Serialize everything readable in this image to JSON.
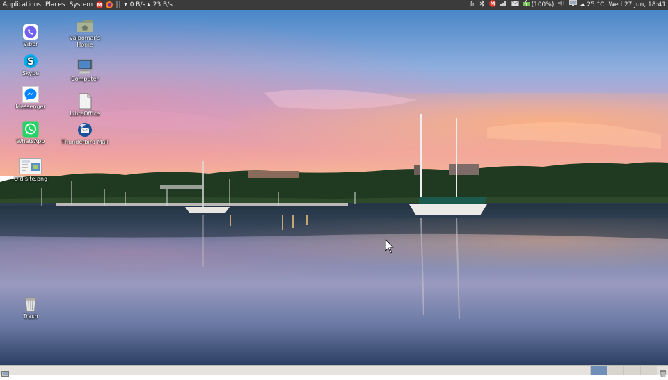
{
  "top_panel": {
    "menus": [
      "Applications",
      "Places",
      "System"
    ],
    "net_down": "0 B/s",
    "net_up": "23 B/s",
    "keyboard_layout": "fr",
    "battery": "(100%)",
    "weather": "25 °C",
    "clock": "Wed 27 Jun, 18:41"
  },
  "desktop": {
    "icons": [
      {
        "name": "Viber",
        "icon": "viber-icon"
      },
      {
        "name": "Skype",
        "icon": "skype-icon"
      },
      {
        "name": "Messenger",
        "icon": "messenger-icon"
      },
      {
        "name": "WhatsApp",
        "icon": "whatsapp-icon"
      },
      {
        "name": "Old site.png",
        "icon": "image-file-icon"
      },
      {
        "name": "valpomar's\nHome",
        "icon": "home-folder-icon"
      },
      {
        "name": "Computer",
        "icon": "computer-icon"
      },
      {
        "name": "LibreOffice",
        "icon": "libreoffice-icon"
      },
      {
        "name": "Thunderbird Mail",
        "icon": "thunderbird-icon"
      },
      {
        "name": "Trash",
        "icon": "trash-icon"
      }
    ]
  },
  "colors": {
    "panel": "#3b3b3b",
    "viber": "#7360f2",
    "skype": "#00aff0",
    "messenger": "#0084ff",
    "whatsapp": "#25d366",
    "gmail_red": "#d93025",
    "workspace_active": "#6f8fb8"
  }
}
